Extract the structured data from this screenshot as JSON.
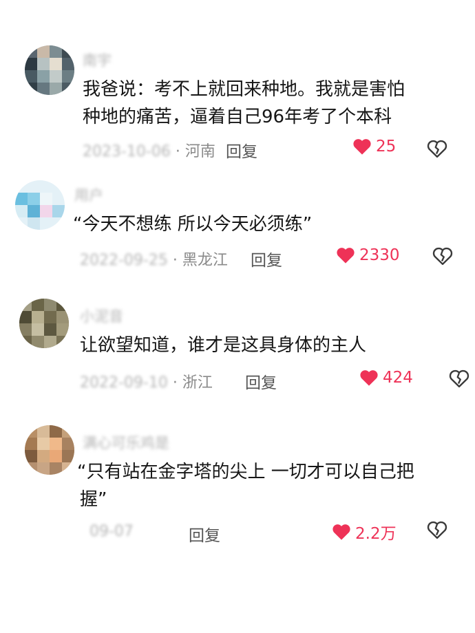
{
  "colors": {
    "like": "#ee3257",
    "text": "#161616",
    "meta": "#8a8a8a"
  },
  "comments": [
    {
      "username": "南宇",
      "text_lines": [
        "我爸说：考不上就回来种地。我就是害怕",
        "种地的痛苦，逼着自己96年考了个本科"
      ],
      "date_blurred": "2023-10-06",
      "location": "· 河南",
      "reply_label": "回复",
      "likes": "25"
    },
    {
      "username": "用户",
      "text_lines": [
        "“今天不想练 所以今天必须练”"
      ],
      "date_blurred": "2022-09-25",
      "location": "· 黑龙江",
      "reply_label": "回复",
      "likes": "2330"
    },
    {
      "username": "小泥音",
      "text_lines": [
        "让欲望知道，谁才是这具身体的主人"
      ],
      "date_blurred": "2022-09-10",
      "location": "· 浙江",
      "reply_label": "回复",
      "likes": "424"
    },
    {
      "username": "满心可乐鸡是",
      "text_lines": [
        "“只有站在金字塔的尖上 一切才可以自己把",
        "握”"
      ],
      "date_blurred": "09-07",
      "location": "",
      "reply_label": "回复",
      "likes": "2.2万"
    }
  ]
}
